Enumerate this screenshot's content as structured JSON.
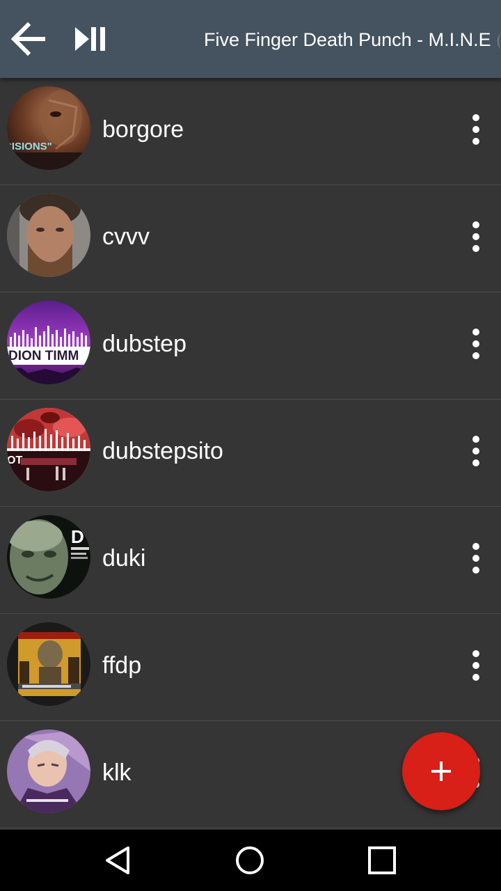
{
  "toolbar": {
    "back_icon": "arrow-back-icon",
    "play_pause_icon": "play-pause-icon",
    "now_playing": "Five Finger Death Punch - M.I.N.E ("
  },
  "playlists": [
    {
      "label": "borgore",
      "icon": "playlist-thumbnail",
      "menu_icon": "more-vert-icon"
    },
    {
      "label": "cvvv",
      "icon": "playlist-thumbnail",
      "menu_icon": "more-vert-icon"
    },
    {
      "label": "dubstep",
      "icon": "playlist-thumbnail",
      "menu_icon": "more-vert-icon"
    },
    {
      "label": "dubstepsito",
      "icon": "playlist-thumbnail",
      "menu_icon": "more-vert-icon"
    },
    {
      "label": "duki",
      "icon": "playlist-thumbnail",
      "menu_icon": "more-vert-icon"
    },
    {
      "label": "ffdp",
      "icon": "playlist-thumbnail",
      "menu_icon": "more-vert-icon"
    },
    {
      "label": "klk",
      "icon": "playlist-thumbnail",
      "menu_icon": "more-vert-icon"
    }
  ],
  "thumb_text": {
    "borgore": "CISIONS\"",
    "dubstep": "DION TIMM",
    "dubstepsito": "OT",
    "duki": "D"
  },
  "fab": {
    "icon": "plus-icon"
  },
  "navbar": {
    "back_icon": "nav-back-icon",
    "home_icon": "nav-home-icon",
    "recents_icon": "nav-recents-icon"
  },
  "colors": {
    "toolbar": "#455360",
    "background": "#353535",
    "fab": "#d81f18",
    "text": "#ffffff"
  }
}
